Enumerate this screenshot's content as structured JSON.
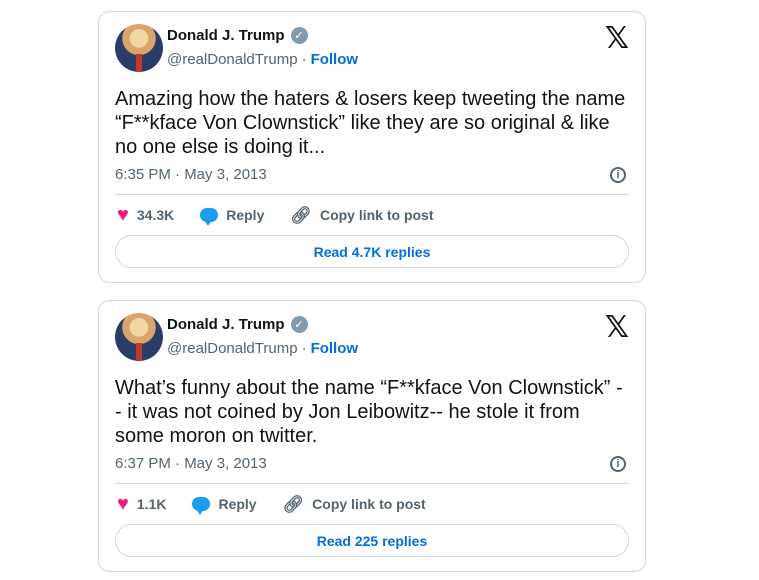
{
  "tweets": [
    {
      "name": "Donald J. Trump",
      "handle": "@realDonaldTrump",
      "separator": "·",
      "follow_label": "Follow",
      "text": "Amazing how the haters & losers keep tweeting the name “F**kface Von Clownstick” like they are so original & like no one else is doing it...",
      "timestamp": "6:35 PM · May 3, 2013",
      "likes": "34.3K",
      "reply_label": "Reply",
      "copy_label": "Copy link to post",
      "read_replies_label": "Read 4.7K replies"
    },
    {
      "name": "Donald J. Trump",
      "handle": "@realDonaldTrump",
      "separator": "·",
      "follow_label": "Follow",
      "text": "What’s funny about the name “F**kface Von Clownstick” -- it was not coined by Jon Leibowitz-- he stole it from some moron on twitter.",
      "timestamp": "6:37 PM · May 3, 2013",
      "likes": "1.1K",
      "reply_label": "Reply",
      "copy_label": "Copy link to post",
      "read_replies_label": "Read 225 replies"
    }
  ],
  "icons": {
    "brand": "x-logo-icon",
    "verified": "verified-badge-icon",
    "info": "info-icon",
    "like": "heart-icon",
    "reply": "reply-bubble-icon",
    "copy": "link-icon"
  },
  "colors": {
    "like": "#f91880",
    "reply": "#1d9bf0",
    "follow": "#006fd6",
    "border": "#cfd9de",
    "muted": "#536471"
  }
}
